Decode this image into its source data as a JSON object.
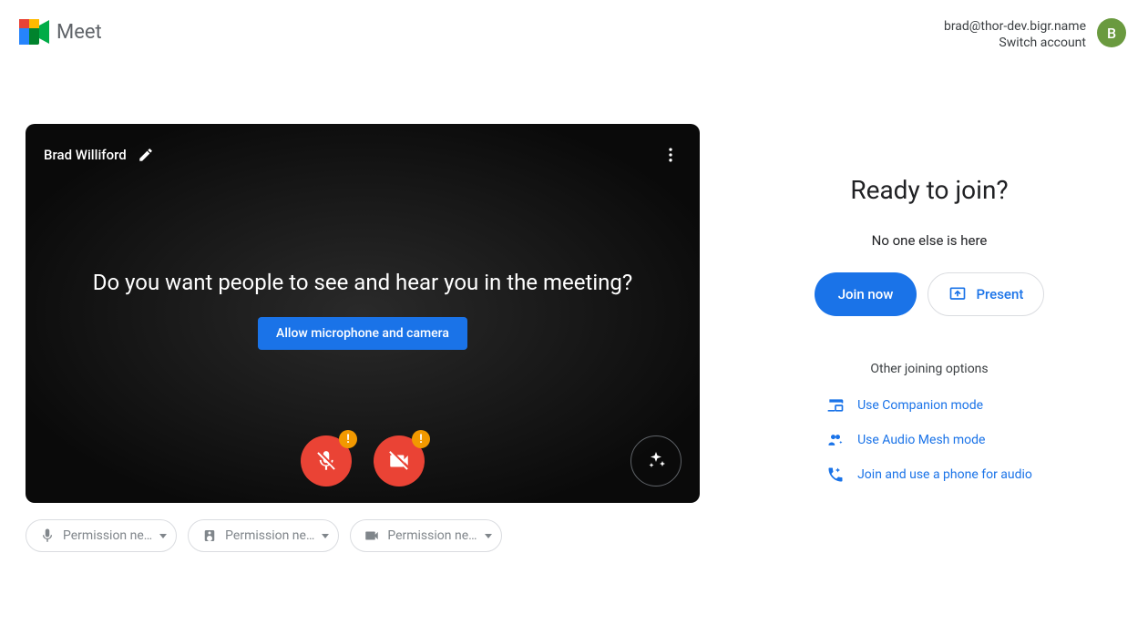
{
  "header": {
    "brand": "Meet",
    "email": "brad@thor-dev.bigr.name",
    "switch": "Switch account",
    "avatar_initial": "B"
  },
  "preview": {
    "username": "Brad Williford",
    "prompt": "Do you want people to see and hear you in the meeting?",
    "allow_label": "Allow microphone and camera",
    "warn": "!"
  },
  "devices": {
    "mic": "Permission ne…",
    "speaker": "Permission ne…",
    "camera": "Permission ne…"
  },
  "join": {
    "heading": "Ready to join?",
    "presence": "No one else is here",
    "join_label": "Join now",
    "present_label": "Present",
    "other_heading": "Other joining options",
    "options": {
      "companion": "Use Companion mode",
      "audiomesh": "Use Audio Mesh mode",
      "phone": "Join and use a phone for audio"
    }
  }
}
